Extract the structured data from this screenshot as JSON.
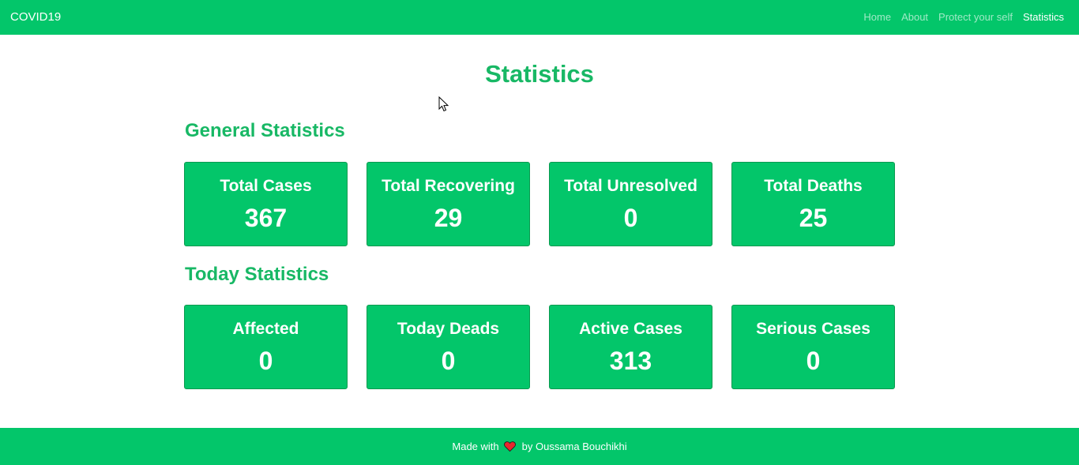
{
  "navbar": {
    "brand": "COVID19",
    "links": [
      {
        "label": "Home"
      },
      {
        "label": "About"
      },
      {
        "label": "Protect your self"
      },
      {
        "label": "Statistics"
      }
    ]
  },
  "page": {
    "title": "Statistics"
  },
  "general": {
    "title": "General Statistics",
    "cards": [
      {
        "label": "Total Cases",
        "value": "367"
      },
      {
        "label": "Total Recovering",
        "value": "29"
      },
      {
        "label": "Total Unresolved",
        "value": "0"
      },
      {
        "label": "Total Deaths",
        "value": "25"
      }
    ]
  },
  "today": {
    "title": "Today Statistics",
    "cards": [
      {
        "label": "Affected",
        "value": "0"
      },
      {
        "label": "Today Deads",
        "value": "0"
      },
      {
        "label": "Active Cases",
        "value": "313"
      },
      {
        "label": "Serious Cases",
        "value": "0"
      }
    ]
  },
  "footer": {
    "prefix": "Made with",
    "suffix": "by Oussama Bouchikhi",
    "icon": "heart-icon"
  },
  "colors": {
    "brand_green": "#03c66a",
    "title_green": "#18b865",
    "heart_red": "#e8262d"
  }
}
